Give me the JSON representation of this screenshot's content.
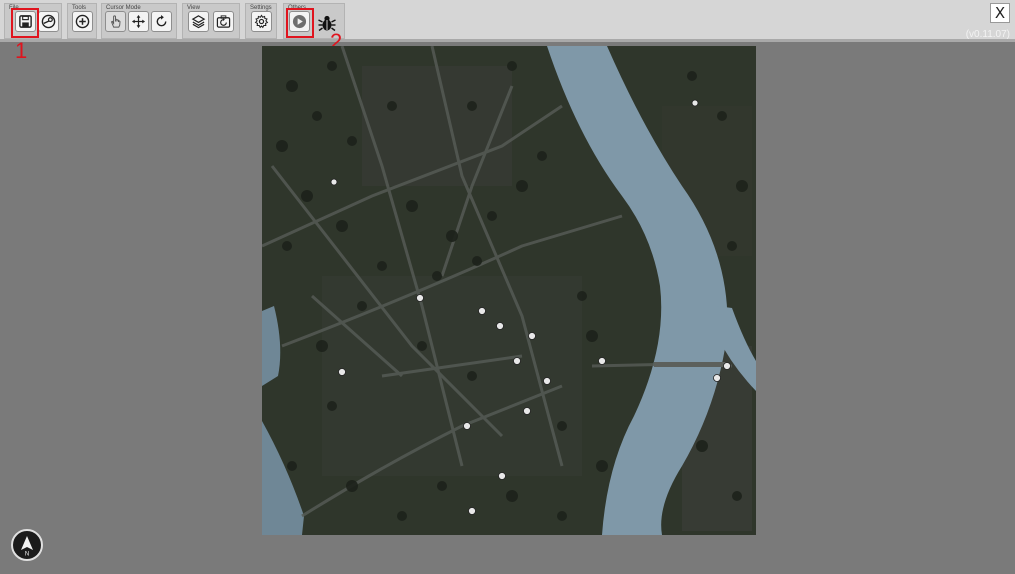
{
  "toolbar": {
    "groups": {
      "file": "File",
      "tools": "Tools",
      "cursor_mode": "Cursor Mode",
      "view": "View",
      "settings": "Settings",
      "others": "Others"
    },
    "buttons": {
      "save": "save-icon",
      "steam": "steam-icon",
      "add": "add-circle-icon",
      "hand": "hand-cursor-icon",
      "move": "move-arrows-icon",
      "rotate": "rotate-icon",
      "layers": "layers-icon",
      "refresh_view": "camera-refresh-icon",
      "settings": "gear-icon",
      "play": "play-icon",
      "bug": "bug-icon"
    }
  },
  "annotations": {
    "one": "1",
    "two": "2"
  },
  "window": {
    "close_label": "X",
    "version": "(v0.11.07)"
  },
  "compass": {
    "label": "N"
  },
  "colors": {
    "highlight": "#e0141e",
    "background": "#7a7a7a",
    "river": "#7f98a8",
    "land": "#2f362b"
  }
}
